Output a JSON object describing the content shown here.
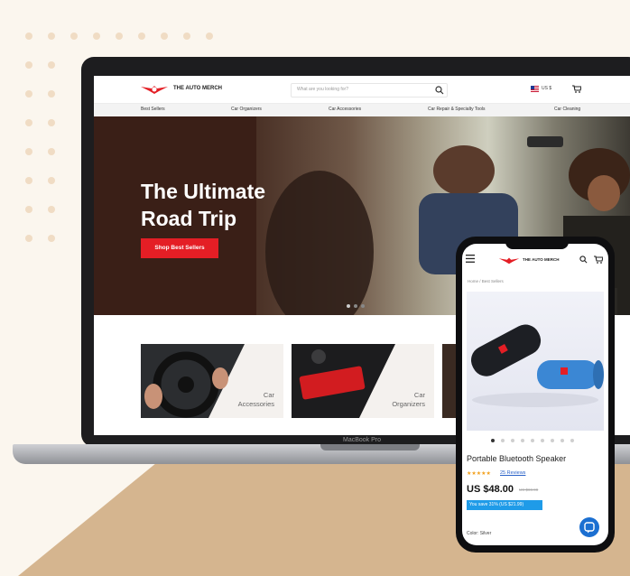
{
  "site": {
    "logo_text": "THE AUTO MERCH",
    "search_placeholder": "What are you looking for?",
    "currency": "US $",
    "nav": [
      "Best Sellers",
      "Car Organizers",
      "Car Accessories",
      "Car Repair & Specialty Tools",
      "Car Cleaning"
    ],
    "hero_line1": "The Ultimate",
    "hero_line2": "Road Trip",
    "hero_cta": "Shop Best Sellers",
    "cards": [
      {
        "line1": "Car",
        "line2": "Accessories"
      },
      {
        "line1": "Car",
        "line2": "Organizers"
      }
    ]
  },
  "laptop": {
    "model": "MacBook Pro"
  },
  "phone": {
    "logo_text": "THE AUTO MERCH",
    "breadcrumb": "Home  /  Best Sellers",
    "product_title": "Portable Bluetooth Speaker",
    "stars": "★★★★★",
    "reviews": "25 Reviews",
    "price": "US $48.00",
    "was_price": "US $69.99",
    "savings": "You save 31% (US $21.99)",
    "color_label": "Color: Silver",
    "image_count": 9
  },
  "colors": {
    "brand_red": "#e41e25",
    "save_blue": "#1f9be8",
    "chat_blue": "#1b6fd1",
    "tan": "#d5b58f"
  }
}
